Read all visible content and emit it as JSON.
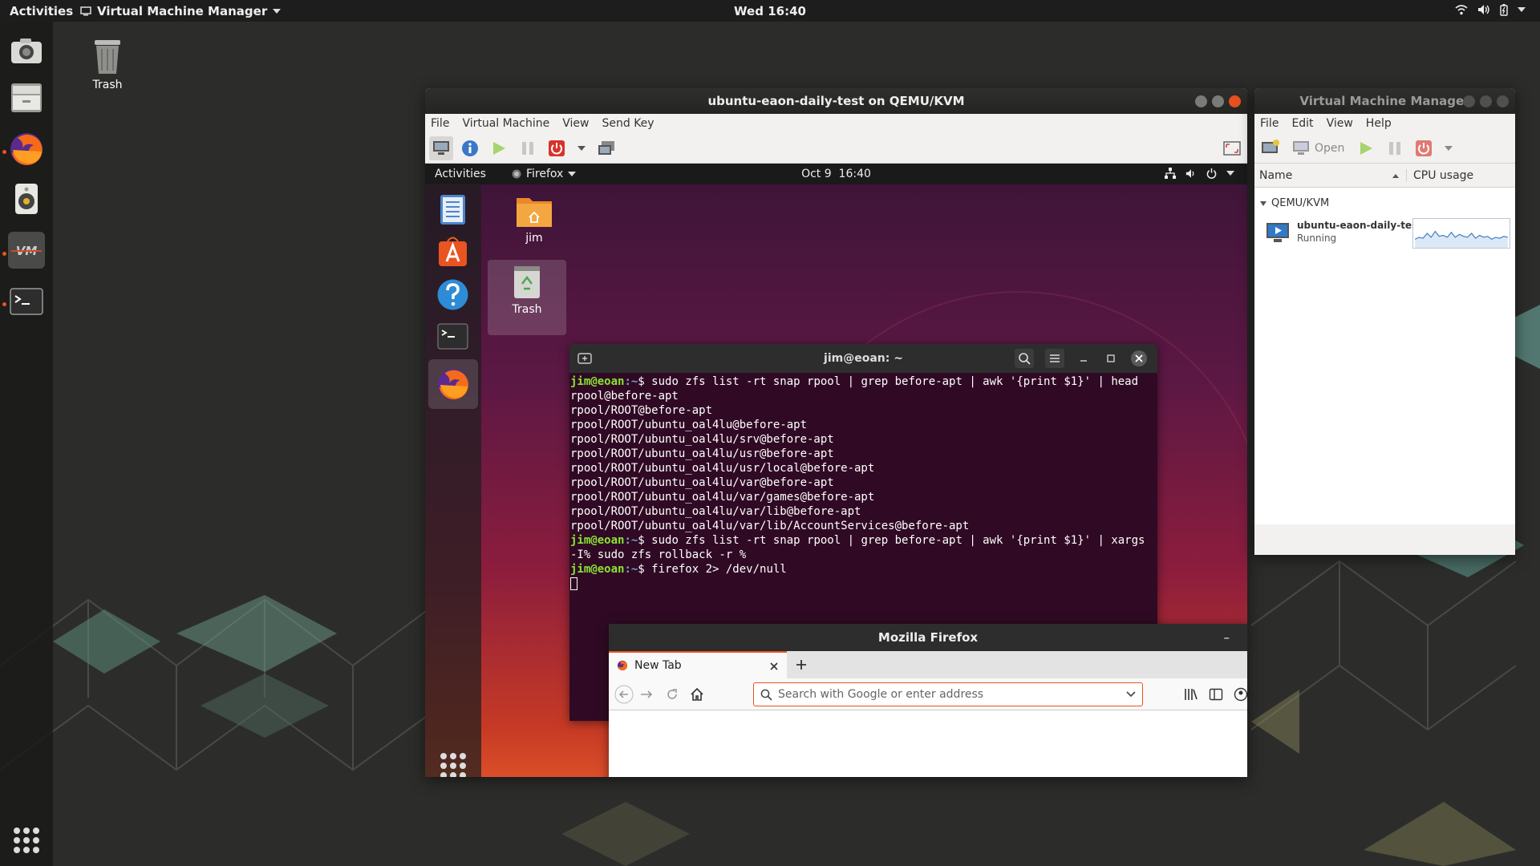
{
  "host": {
    "topbar": {
      "activities": "Activities",
      "app_menu": "Virtual Machine Manager",
      "clock": "Wed 16:40",
      "tray_icons": [
        "network-icon",
        "volume-icon",
        "battery-icon",
        "chevron-down-icon"
      ]
    },
    "dock": {
      "items": [
        "screenshot-app-icon",
        "file-manager-icon",
        "firefox-icon",
        "rhythmbox-icon",
        "virt-manager-icon",
        "terminal-icon"
      ]
    },
    "desktop": {
      "trash_label": "Trash"
    }
  },
  "viewer": {
    "title": "ubuntu-eaon-daily-test on QEMU/KVM",
    "menu": [
      "File",
      "Virtual Machine",
      "View",
      "Send Key"
    ]
  },
  "guest": {
    "topbar": {
      "activities": "Activities",
      "app": "Firefox",
      "clock": "Oct 9  16:40"
    },
    "desktop": {
      "home_label": "jim",
      "trash_label": "Trash"
    },
    "terminal": {
      "title": "jim@eoan: ~",
      "prompt_user": "jim@eoan",
      "prompt_path": ":~",
      "prompt_sym": "$",
      "cmd1": " sudo zfs list -rt snap rpool | grep before-apt | awk '{print $1}' | head",
      "output": [
        "rpool@before-apt",
        "rpool/ROOT@before-apt",
        "rpool/ROOT/ubuntu_oal4lu@before-apt",
        "rpool/ROOT/ubuntu_oal4lu/srv@before-apt",
        "rpool/ROOT/ubuntu_oal4lu/usr@before-apt",
        "rpool/ROOT/ubuntu_oal4lu/usr/local@before-apt",
        "rpool/ROOT/ubuntu_oal4lu/var@before-apt",
        "rpool/ROOT/ubuntu_oal4lu/var/games@before-apt",
        "rpool/ROOT/ubuntu_oal4lu/var/lib@before-apt",
        "rpool/ROOT/ubuntu_oal4lu/var/lib/AccountServices@before-apt"
      ],
      "cmd2": " sudo zfs list -rt snap rpool | grep before-apt | awk '{print $1}' | xargs -I% sudo zfs rollback -r %",
      "cmd3": " firefox 2> /dev/null"
    },
    "firefox": {
      "title": "Mozilla Firefox",
      "tab_label": "New Tab",
      "url_placeholder": "Search with Google or enter address"
    }
  },
  "vmm": {
    "title": "Virtual Machine Manager",
    "menu": [
      "File",
      "Edit",
      "View",
      "Help"
    ],
    "open_label": "Open",
    "col_name": "Name",
    "col_cpu": "CPU usage",
    "group": "QEMU/KVM",
    "vm_name": "ubuntu-eaon-daily-test",
    "vm_status": "Running",
    "cpu_samples": [
      0.2,
      0.3,
      0.25,
      0.5,
      0.3,
      0.6,
      0.35,
      0.4,
      0.3,
      0.55,
      0.3,
      0.45,
      0.35,
      0.3,
      0.5,
      0.25,
      0.4,
      0.3,
      0.35,
      0.2,
      0.3,
      0.25,
      0.35,
      0.3
    ]
  }
}
